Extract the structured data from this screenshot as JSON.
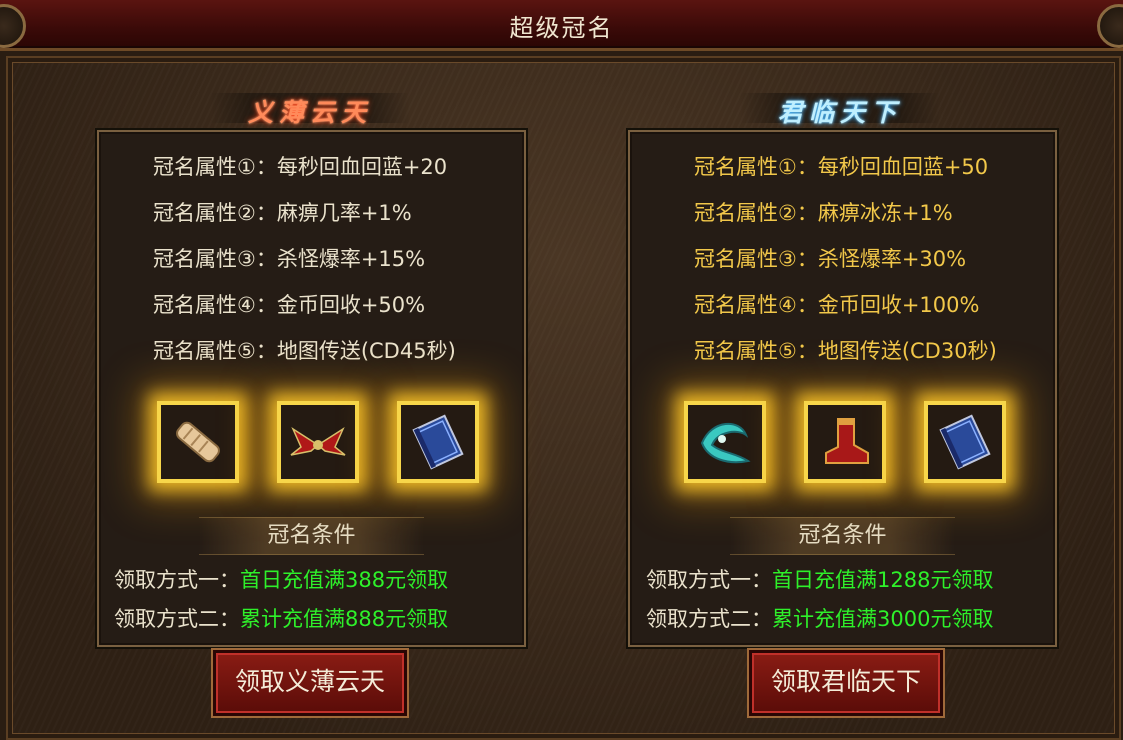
{
  "window": {
    "title": "超级冠名"
  },
  "left": {
    "ribbon": "义薄云天",
    "attributes": [
      "冠名属性①：每秒回血回蓝+20",
      "冠名属性②：麻痹几率+1%",
      "冠名属性③：杀怪爆率+15%",
      "冠名属性④：金币回收+50%",
      "冠名属性⑤：地图传送(CD45秒)"
    ],
    "items": [
      "scroll-icon",
      "red-wings-icon",
      "blue-book-icon"
    ],
    "condition_header": "冠名条件",
    "conditions": [
      {
        "key": "领取方式一：",
        "value": "首日充值满388元领取"
      },
      {
        "key": "领取方式二：",
        "value": "累计充值满888元领取"
      }
    ],
    "button": "领取义薄云天"
  },
  "right": {
    "ribbon": "君临天下",
    "attributes": [
      "冠名属性①：每秒回血回蓝+50",
      "冠名属性②：麻痹冰冻+1%",
      "冠名属性③：杀怪爆率+30%",
      "冠名属性④：金币回收+100%",
      "冠名属性⑤：地图传送(CD30秒)"
    ],
    "items": [
      "cyan-ribbon-icon",
      "red-boot-icon",
      "blue-book-icon"
    ],
    "condition_header": "冠名条件",
    "conditions": [
      {
        "key": "领取方式一：",
        "value": "首日充值满1288元领取"
      },
      {
        "key": "领取方式二：",
        "value": "累计充值满3000元领取"
      }
    ],
    "button": "领取君临天下"
  },
  "colors": {
    "attr_left": "#eae2cc",
    "attr_right": "#f2c84a",
    "condition_value": "#2ef02a",
    "item_glow": "#f7d64a",
    "button_bg": "#8a1c14"
  }
}
